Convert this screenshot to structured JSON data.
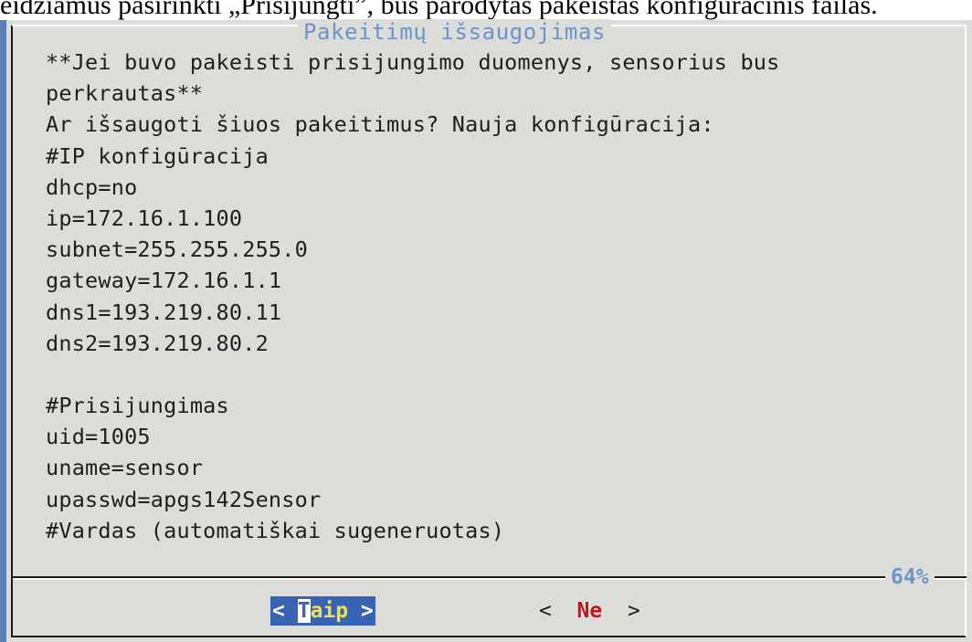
{
  "document": {
    "partial_text": "eidžiamus pasirinkti „Prisijungti”, bus parodytas pakeistas konfigūracinis failas."
  },
  "dialog": {
    "title": "Pakeitimų išsaugojimas",
    "lines": [
      "**Jei buvo pakeisti prisijungimo duomenys, sensorius bus",
      "perkrautas**",
      "Ar išsaugoti šiuos pakeitimus? Nauja konfigūracija:",
      "#IP konfigūracija",
      "dhcp=no",
      "ip=172.16.1.100",
      "subnet=255.255.255.0",
      "gateway=172.16.1.1",
      "dns1=193.219.80.11",
      "dns2=193.219.80.2",
      "",
      "#Prisijungimas",
      "uid=1005",
      "uname=sensor",
      "upasswd=apgs142Sensor",
      "#Vardas (automatiškai sugeneruotas)"
    ],
    "scroll_percent": "64%",
    "buttons": {
      "yes": {
        "open": "< ",
        "hotkey": "T",
        "rest": "aip",
        "close": " >"
      },
      "no": {
        "open": "<  ",
        "hotkey": "N",
        "rest": "e",
        "close": "  >"
      }
    }
  },
  "colors": {
    "dialog_bg": "#dcdcd9",
    "title": "#6b95c9",
    "button_selected_bg": "#3765b3",
    "button_hotkey": "#f0e04a",
    "button_no_text": "#c81414",
    "left_edge": "#5a7fb5"
  }
}
